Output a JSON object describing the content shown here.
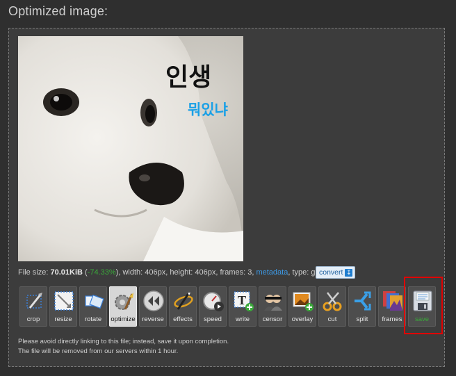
{
  "heading": "Optimized image:",
  "image": {
    "caption_line1": "인생",
    "caption_line2": "뭐있냐"
  },
  "info": {
    "file_size_label": "File size: ",
    "file_size_value": "70.01KiB",
    "open_paren": " (",
    "percent": "-74.33%",
    "after_percent": "), width: 406px, height: 406px, frames: 3, ",
    "metadata_link": "metadata",
    "type_text": ", type: gif",
    "convert_label": "convert",
    "convert_icon": "download-icon"
  },
  "tools": [
    {
      "label": "crop",
      "icon": "crop-icon"
    },
    {
      "label": "resize",
      "icon": "resize-icon"
    },
    {
      "label": "rotate",
      "icon": "rotate-icon"
    },
    {
      "label": "optimize",
      "icon": "optimize-icon",
      "active": true
    },
    {
      "label": "reverse",
      "icon": "reverse-icon"
    },
    {
      "label": "effects",
      "icon": "effects-icon"
    },
    {
      "label": "speed",
      "icon": "speed-icon"
    },
    {
      "label": "write",
      "icon": "write-icon"
    },
    {
      "label": "censor",
      "icon": "censor-icon"
    },
    {
      "label": "overlay",
      "icon": "overlay-icon"
    },
    {
      "label": "cut",
      "icon": "cut-icon"
    },
    {
      "label": "split",
      "icon": "split-icon"
    },
    {
      "label": "frames",
      "icon": "frames-icon"
    },
    {
      "label": "save",
      "icon": "floppy-disk-icon"
    }
  ],
  "notes": [
    "Please avoid directly linking to this file; instead, save it upon completion.",
    "The file will be removed from our servers within 1 hour."
  ],
  "colors": {
    "background": "#2f2f2f",
    "panel": "#3c3c3c",
    "accent_link": "#3d9be8",
    "percent_green": "#3aa83a",
    "highlight_red": "#e00000",
    "caption_blue": "#1aa0e6"
  }
}
